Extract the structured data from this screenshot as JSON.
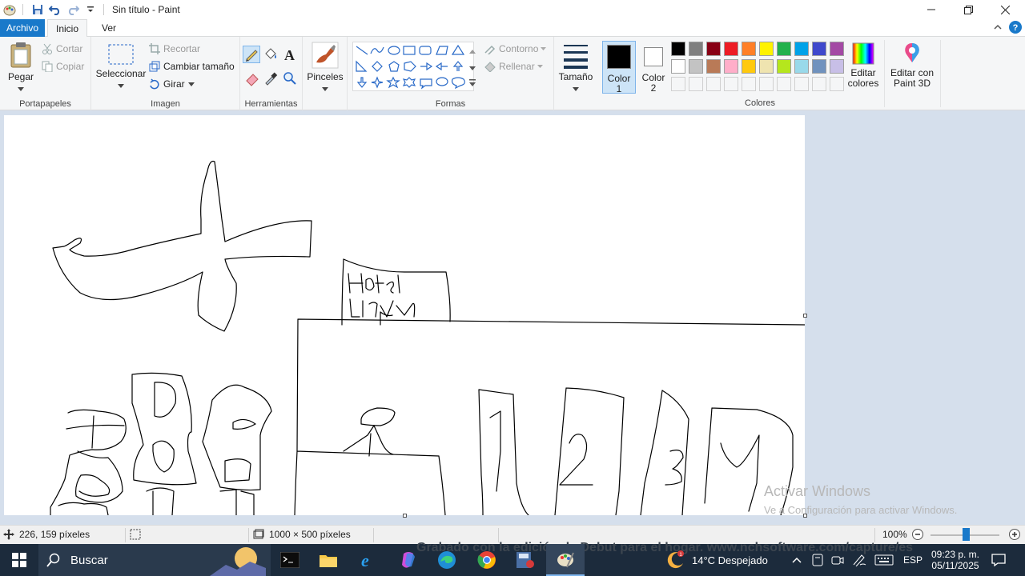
{
  "window": {
    "title": "Sin título - Paint"
  },
  "tabs": {
    "archivo": "Archivo",
    "inicio": "Inicio",
    "ver": "Ver"
  },
  "ribbon": {
    "portapapeles": {
      "label": "Portapapeles",
      "pegar": "Pegar",
      "cortar": "Cortar",
      "copiar": "Copiar"
    },
    "imagen": {
      "label": "Imagen",
      "seleccionar": "Seleccionar",
      "recortar": "Recortar",
      "cambiar_tamano": "Cambiar tamaño",
      "girar": "Girar"
    },
    "herramientas": {
      "label": "Herramientas"
    },
    "pinceles": {
      "label": "Pinceles"
    },
    "formas": {
      "label": "Formas",
      "contorno": "Contorno",
      "rellenar": "Rellenar"
    },
    "tamano": {
      "label": "Tamaño"
    },
    "color1": {
      "label_line1": "Color",
      "label_line2": "1"
    },
    "color2": {
      "label_line1": "Color",
      "label_line2": "2"
    },
    "colores": {
      "label": "Colores"
    },
    "editar_colores": {
      "line1": "Editar",
      "line2": "colores"
    },
    "editar_3d": {
      "line1": "Editar con",
      "line2": "Paint 3D"
    }
  },
  "palette": {
    "row1": [
      "#000000",
      "#7f7f7f",
      "#880015",
      "#ed1c24",
      "#ff7f27",
      "#fff200",
      "#22b14c",
      "#00a2e8",
      "#3f48cc",
      "#a349a4"
    ],
    "row2": [
      "#ffffff",
      "#c3c3c3",
      "#b97a57",
      "#ffaec9",
      "#ffc90e",
      "#efe4b0",
      "#b5e61d",
      "#99d9ea",
      "#7092be",
      "#c8bfe7"
    ],
    "color1": "#000000",
    "color2": "#ffffff"
  },
  "canvas": {
    "label_hotel_line1": "Hotel",
    "label_hotel_line2": "Lirant",
    "floor_numbers": [
      "1",
      "2",
      "3",
      "4"
    ]
  },
  "watermark": {
    "line1": "Activar Windows",
    "line2": "Ve a Configuración para activar Windows."
  },
  "status": {
    "cursor": "226, 159 píxeles",
    "canvas_size": "1000 × 500 píxeles",
    "zoom": "100%"
  },
  "taskbar": {
    "search_placeholder": "Buscar",
    "banner": "Grabado con la edición de Debut para el hogar. www.nchsoftware.com/capture/es",
    "weather": "14°C  Despejado",
    "language": "ESP",
    "time": "09:23 p. m.",
    "date": "05/11/2025"
  }
}
